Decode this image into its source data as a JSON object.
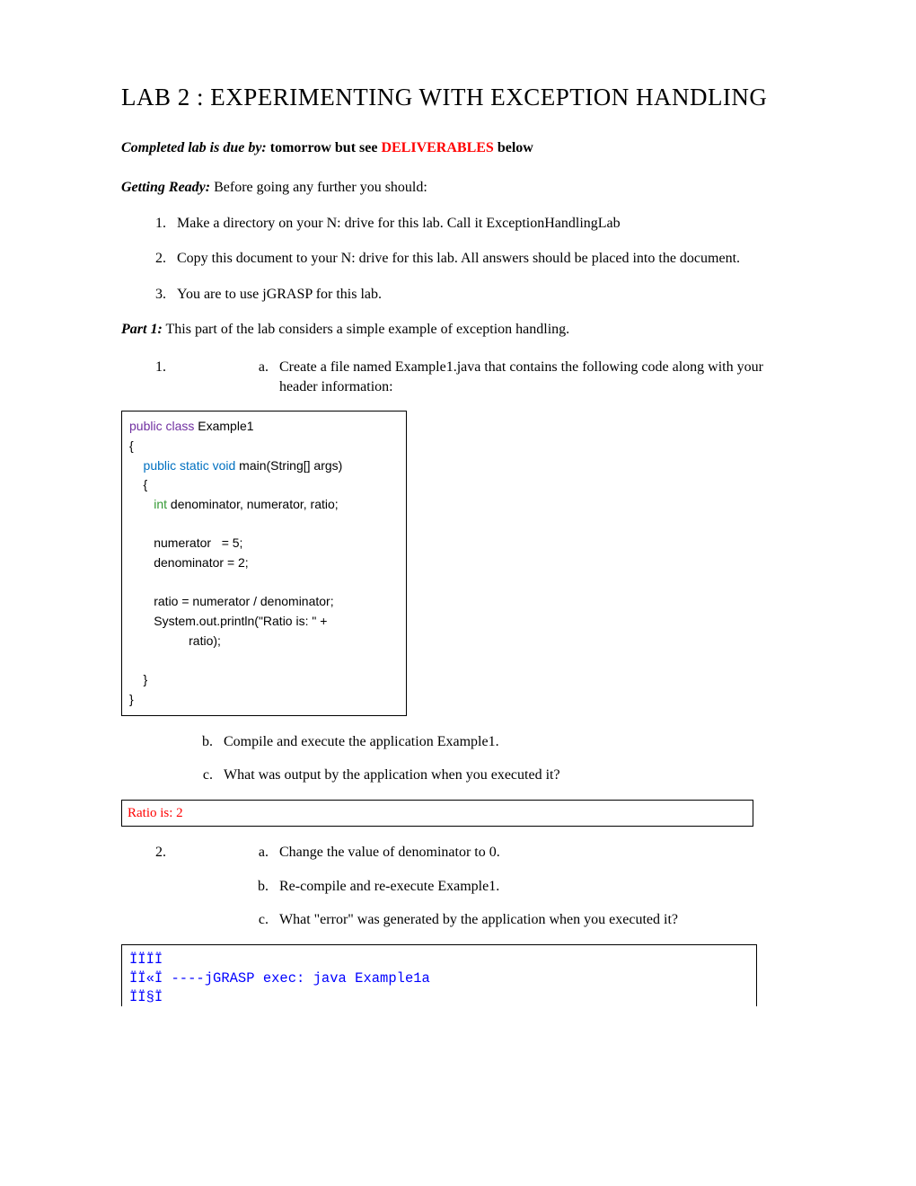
{
  "title": "LAB  2 : EXPERIMENTING WITH EXCEPTION HANDLING",
  "due": {
    "label": "Completed lab is due by:",
    "text1": "  tomorrow but see ",
    "deliverables": "DELIVERABLES",
    "text2": " below"
  },
  "getting_ready": {
    "label": "Getting Ready:",
    "text": " Before going any further you should:"
  },
  "ready_items": [
    "Make a directory on your N: drive for this lab. Call it ExceptionHandlingLab",
    "Copy this document to your N: drive for this lab.   All answers should be placed into the document.",
    "You are to use jGRASP for this lab."
  ],
  "part1": {
    "label": "Part 1:",
    "text": " This part of the lab considers a simple example of exception handling."
  },
  "s1": {
    "a": "Create a file named Example1.java that contains the following code along with your header information:",
    "b": "Compile and execute  the application Example1.",
    "c": "What was output by the application when you executed it?",
    "answer": "Ratio is:  2"
  },
  "code": {
    "l1a": "public class",
    "l1b": " Example1",
    "l2": "{",
    "l3a": "    public static void",
    "l3b": " main(String[] args)",
    "l4": "    {",
    "l5a": "       int",
    "l5b": " denominator, numerator, ratio;",
    "l6": "",
    "l7": "       numerator   = 5;",
    "l8": "       denominator = 2;",
    "l9": "",
    "l10": "       ratio = numerator / denominator;",
    "l11": "       System.out.println(\"Ratio is: \" +",
    "l12": "                 ratio);",
    "l13": "",
    "l14": "    }",
    "l15": "}"
  },
  "s2": {
    "a": "Change the value of denominator to 0.",
    "b": "Re-compile and re-execute Example1.",
    "c": "What \"error\" was generated by the application when you executed it?"
  },
  "error_output": "ÏÏÏÏ\nÏÏ«Ï ----jGRASP exec: java Example1a\nÏÏ§Ï"
}
